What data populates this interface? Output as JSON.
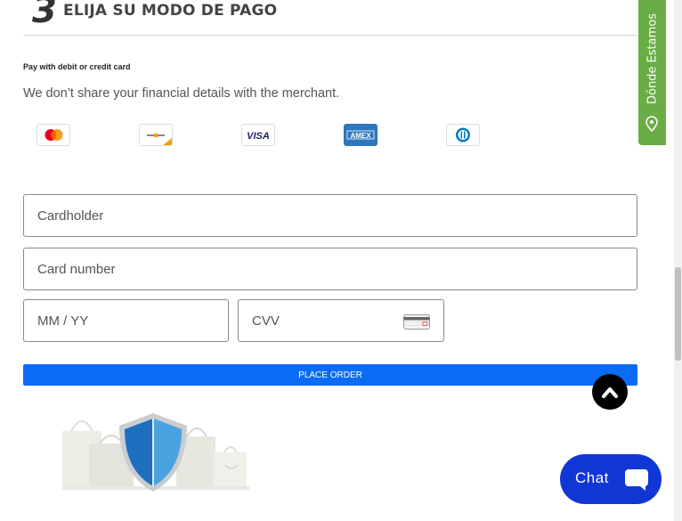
{
  "step": {
    "number": "3",
    "title": "ELIJA SU MODO DE PAGO"
  },
  "payment": {
    "label": "Pay with debit or credit card",
    "privacy_note": "We don’t share your financial details with the merchant.",
    "card_logos": [
      {
        "name": "mastercard-logo"
      },
      {
        "name": "maestro-logo"
      },
      {
        "name": "visa-logo",
        "text": "VISA"
      },
      {
        "name": "amex-logo",
        "text": "AMEX"
      },
      {
        "name": "diners-club-logo"
      }
    ]
  },
  "form": {
    "cardholder_placeholder": "Cardholder",
    "card_number_placeholder": "Card number",
    "expiry_placeholder": "MM / YY",
    "cvv_placeholder": "CVV",
    "place_order_label": "PLACE ORDER"
  },
  "chat": {
    "label": "Chat"
  },
  "side_tab": {
    "label": "Dónde Estamos"
  },
  "colors": {
    "primary_button": "#0a6cf5",
    "chat_button": "#1136d6",
    "side_tab": "#6aac46",
    "shield": "#4a90d9"
  }
}
